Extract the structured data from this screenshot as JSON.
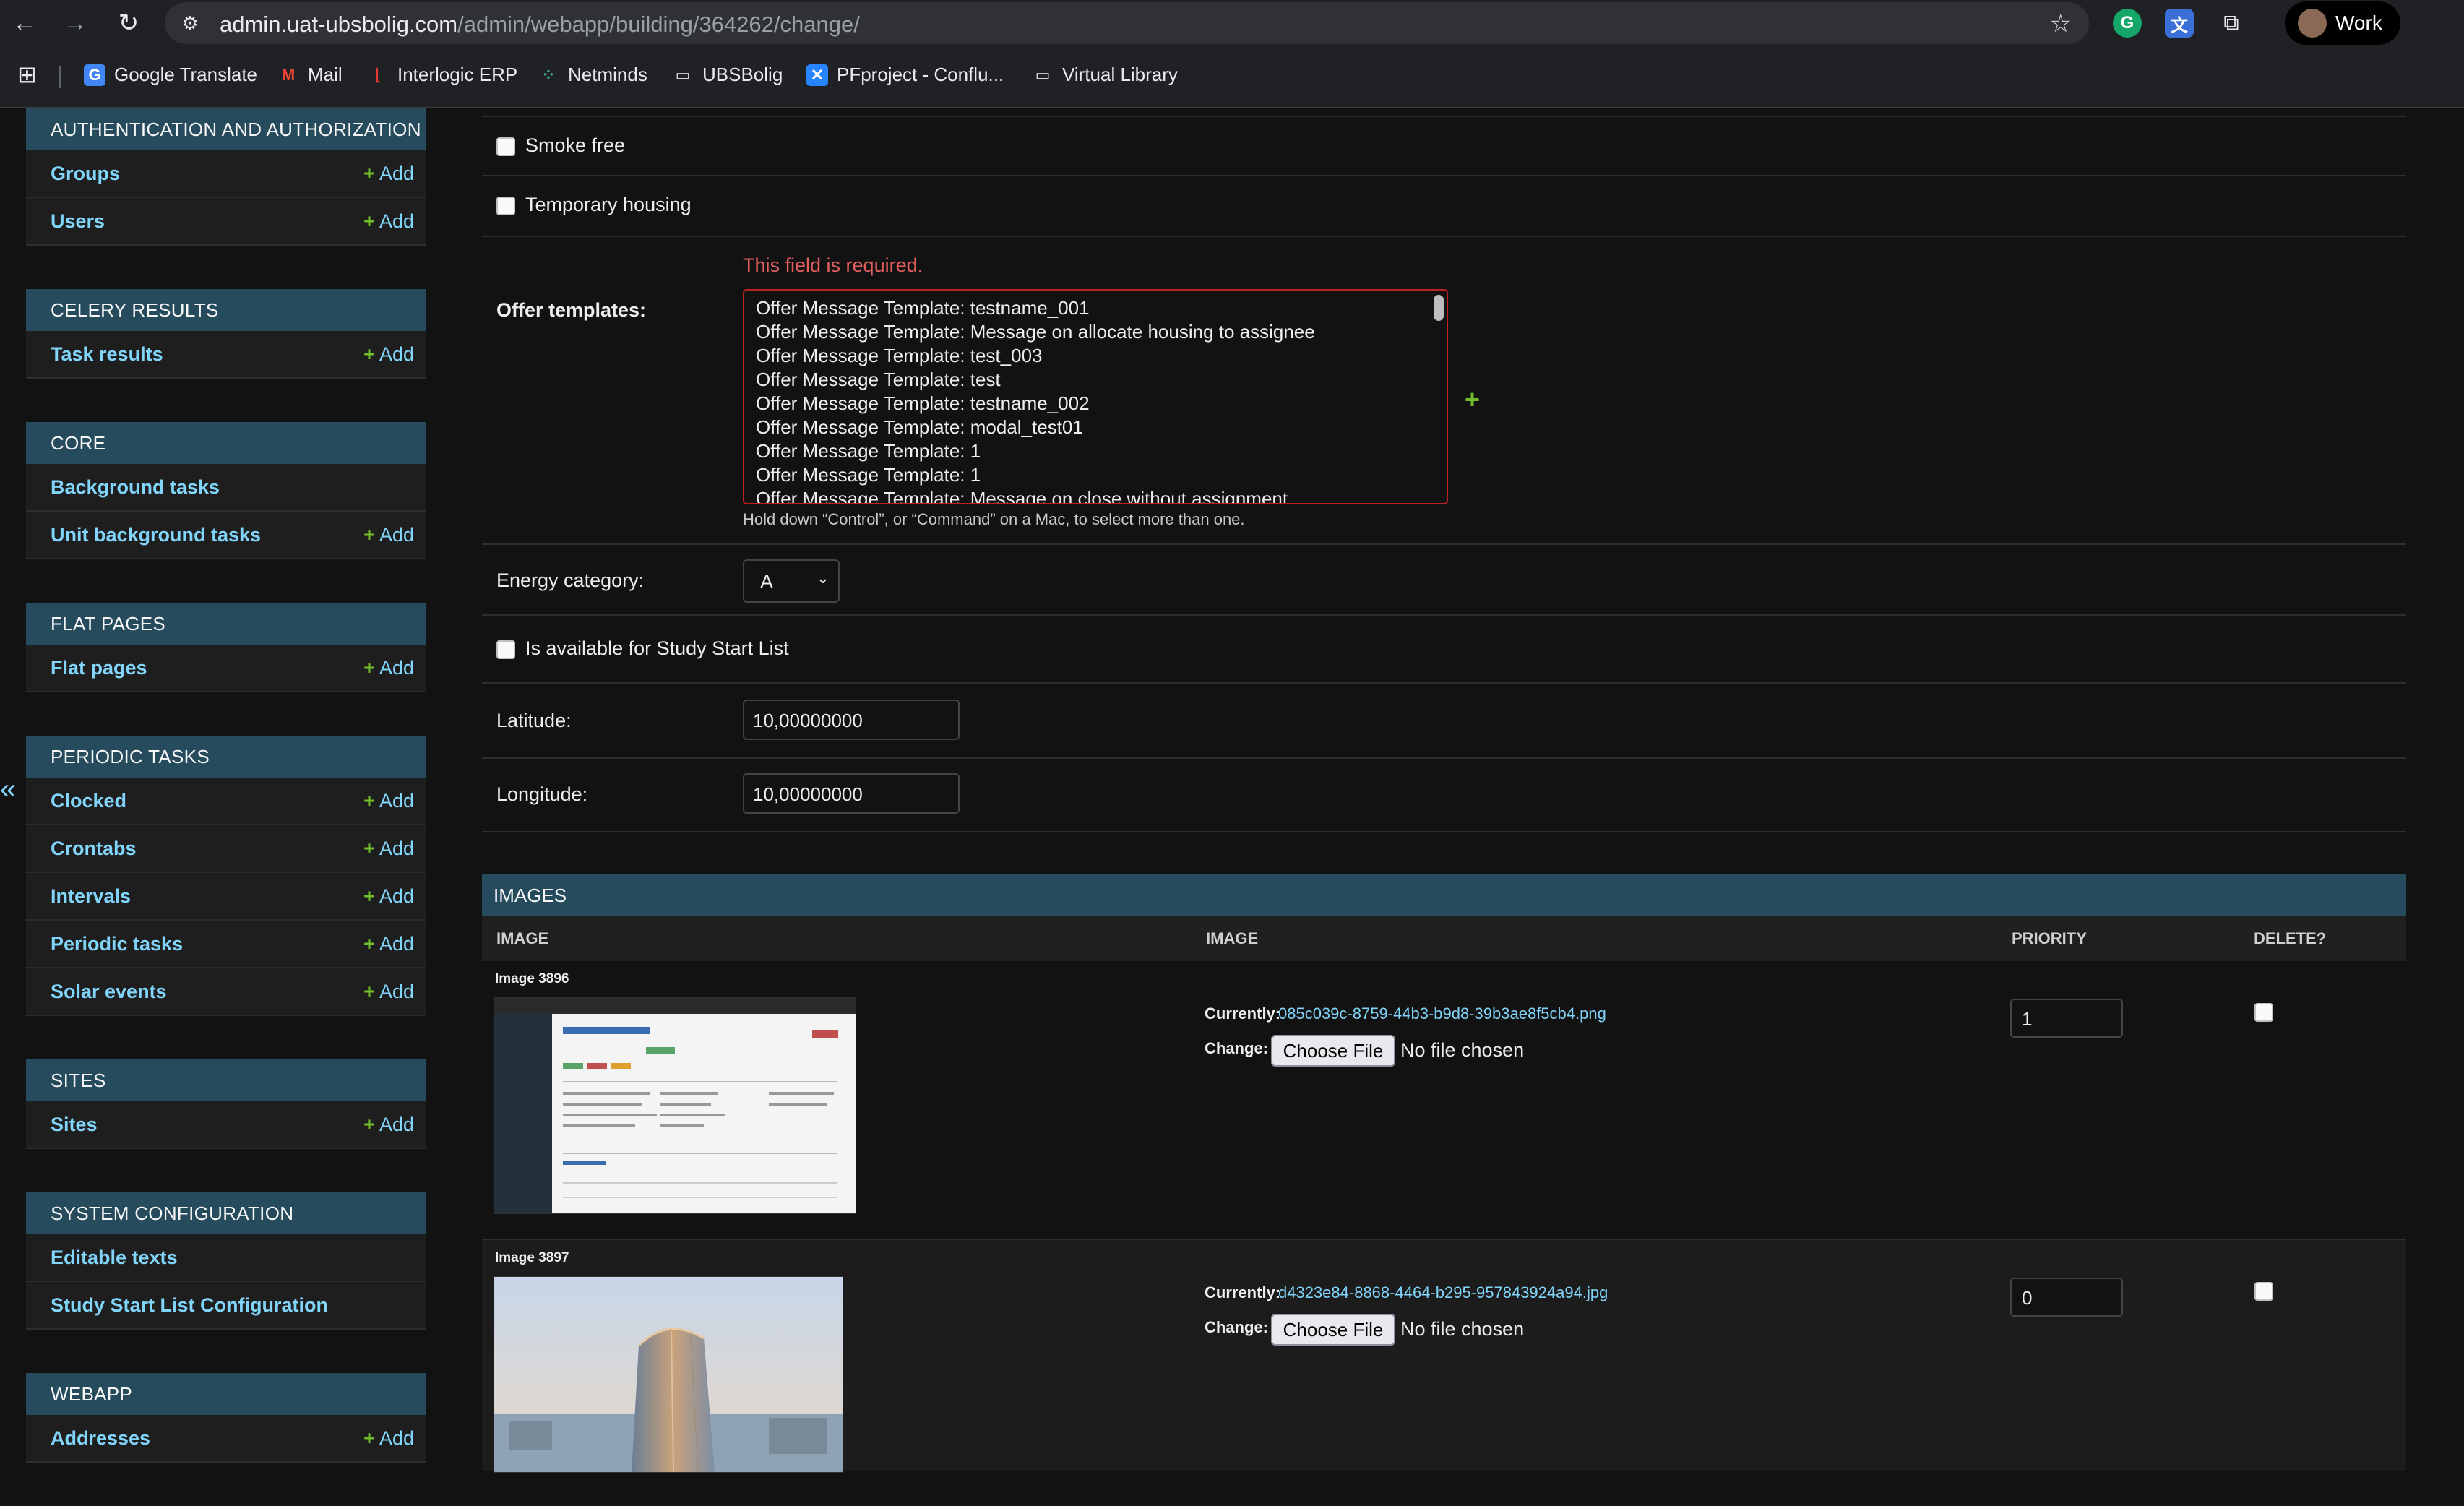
{
  "browser": {
    "url_host": "admin.uat-ubsbolig.com",
    "url_path": "/admin/webapp/building/364262/change/",
    "profile_name": "Work",
    "bookmarks": [
      {
        "label": "Google Translate",
        "icon": "google-translate-icon"
      },
      {
        "label": "Mail",
        "icon": "gmail-icon"
      },
      {
        "label": "Interlogic ERP",
        "icon": "interlogic-icon"
      },
      {
        "label": "Netminds",
        "icon": "netminds-icon"
      },
      {
        "label": "UBSBolig",
        "icon": "folder-icon"
      },
      {
        "label": "PFproject - Conflu...",
        "icon": "confluence-icon"
      },
      {
        "label": "Virtual Library",
        "icon": "folder-icon"
      }
    ]
  },
  "sidebar": {
    "collapse_glyph": "«",
    "add_label": "Add",
    "modules": [
      {
        "caption": "Authentication and Authorization",
        "models": [
          {
            "name": "Groups",
            "add": true
          },
          {
            "name": "Users",
            "add": true
          }
        ]
      },
      {
        "caption": "Celery Results",
        "models": [
          {
            "name": "Task results",
            "add": true
          }
        ]
      },
      {
        "caption": "Core",
        "models": [
          {
            "name": "Background tasks",
            "add": false
          },
          {
            "name": "Unit background tasks",
            "add": true
          }
        ]
      },
      {
        "caption": "Flat Pages",
        "models": [
          {
            "name": "Flat pages",
            "add": true
          }
        ]
      },
      {
        "caption": "Periodic Tasks",
        "models": [
          {
            "name": "Clocked",
            "add": true
          },
          {
            "name": "Crontabs",
            "add": true
          },
          {
            "name": "Intervals",
            "add": true
          },
          {
            "name": "Periodic tasks",
            "add": true
          },
          {
            "name": "Solar events",
            "add": true
          }
        ]
      },
      {
        "caption": "Sites",
        "models": [
          {
            "name": "Sites",
            "add": true
          }
        ]
      },
      {
        "caption": "System Configuration",
        "models": [
          {
            "name": "Editable texts",
            "add": false
          },
          {
            "name": "Study Start List Configuration",
            "add": false
          }
        ]
      },
      {
        "caption": "Webapp",
        "models": [
          {
            "name": "Addresses",
            "add": true
          }
        ]
      }
    ]
  },
  "form": {
    "smoke_free_label": "Smoke free",
    "temporary_housing_label": "Temporary housing",
    "offer_templates": {
      "label": "Offer templates:",
      "error": "This field is required.",
      "options": [
        "Offer Message Template: testname_001",
        "Offer Message Template: Message on allocate housing to assignee",
        "Offer Message Template: test_003",
        "Offer Message Template: test",
        "Offer Message Template: testname_002",
        "Offer Message Template: modal_test01",
        "Offer Message Template: 1",
        "Offer Message Template: 1",
        "Offer Message Template: Message on close without assignment"
      ],
      "help": "Hold down “Control”, or “Command” on a Mac, to select more than one.",
      "add_glyph": "+"
    },
    "energy_category": {
      "label": "Energy category:",
      "value": "A"
    },
    "study_start_label": "Is available for Study Start List",
    "latitude": {
      "label": "Latitude:",
      "value": "10,00000000"
    },
    "longitude": {
      "label": "Longitude:",
      "value": "10,00000000"
    }
  },
  "images": {
    "caption": "IMAGES",
    "columns": [
      "IMAGE",
      "IMAGE",
      "PRIORITY",
      "DELETE?"
    ],
    "currently_label": "Currently:",
    "change_label": "Change:",
    "choose_file_label": "Choose File",
    "no_file_label": "No file chosen",
    "rows": [
      {
        "title": "Image 3896",
        "file": "085c039c-8759-44b3-b9d8-39b3ae8f5cb4.png",
        "priority": "1",
        "thumbnail": "admin-screenshot-thumbnail"
      },
      {
        "title": "Image 3897",
        "file": "d4323e84-8868-4464-b295-957843924a94.jpg",
        "priority": "0",
        "thumbnail": "skyscraper-photo-thumbnail"
      }
    ]
  }
}
